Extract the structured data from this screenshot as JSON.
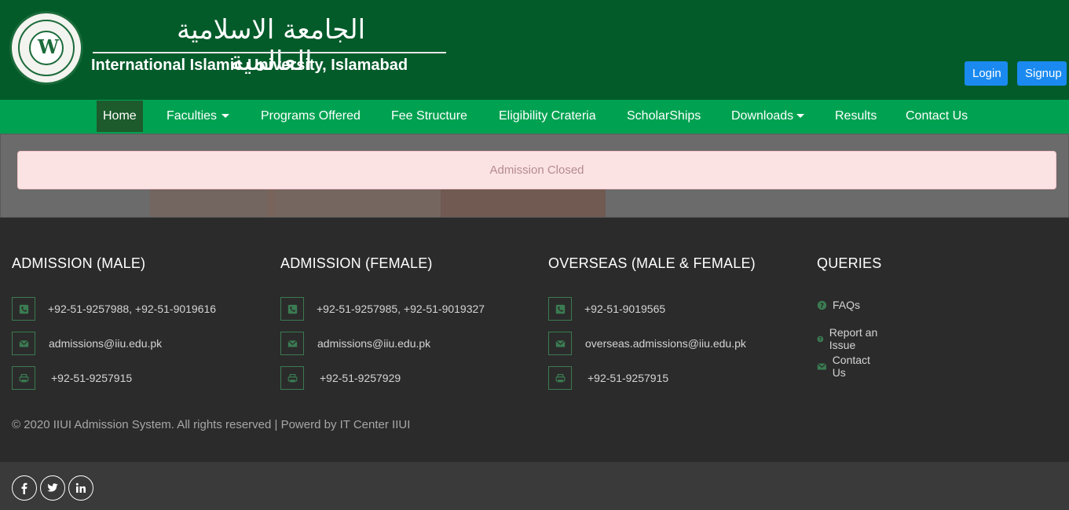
{
  "header": {
    "arabic_title": "الجامعة الاسلامية العالمية",
    "english_title": "International Islamic University, Islamabad",
    "login_label": "Login",
    "signup_label": "Signup"
  },
  "nav": {
    "items": [
      {
        "label": "Home",
        "active": true
      },
      {
        "label": "Faculties",
        "dropdown": true
      },
      {
        "label": "Programs Offered"
      },
      {
        "label": "Fee Structure"
      },
      {
        "label": "Eligibility Crateria"
      },
      {
        "label": "ScholarShips"
      },
      {
        "label": "Downloads",
        "dropdown": true
      },
      {
        "label": "Results"
      },
      {
        "label": "Contact Us"
      }
    ]
  },
  "banner": {
    "alert_text": "Admission Closed"
  },
  "footer": {
    "columns": [
      {
        "title": "ADMISSION (MALE)",
        "phone": "+92-51-9257988, +92-51-9019616",
        "email": "admissions@iiu.edu.pk",
        "fax": "+92-51-9257915"
      },
      {
        "title": "ADMISSION (FEMALE)",
        "phone": "+92-51-9257985, +92-51-9019327",
        "email": "admissions@iiu.edu.pk",
        "fax": "+92-51-9257929"
      },
      {
        "title": "OVERSEAS (MALE & FEMALE)",
        "phone": "+92-51-9019565",
        "email": "overseas.admissions@iiu.edu.pk",
        "fax": "+92-51-9257915"
      }
    ],
    "queries": {
      "title": "QUERIES",
      "items": [
        {
          "label": "FAQs",
          "icon": "question-circle-icon"
        },
        {
          "label": "Report an Issue",
          "icon": "question-circle-icon"
        },
        {
          "label": "Contact Us",
          "icon": "envelope-icon"
        }
      ]
    },
    "copyright": "© 2020 IIUI Admission System. All rights reserved | Powerd by IT Center IIUI",
    "social": [
      "facebook-icon",
      "twitter-icon",
      "linkedin-icon"
    ]
  },
  "colors": {
    "header_bg": "#035b2a",
    "nav_bg": "#00a251",
    "nav_active": "#1d5b2c",
    "button_blue": "#1a8af0",
    "footer_bg": "#2b2b2b",
    "icon_green": "#3b7b52"
  }
}
